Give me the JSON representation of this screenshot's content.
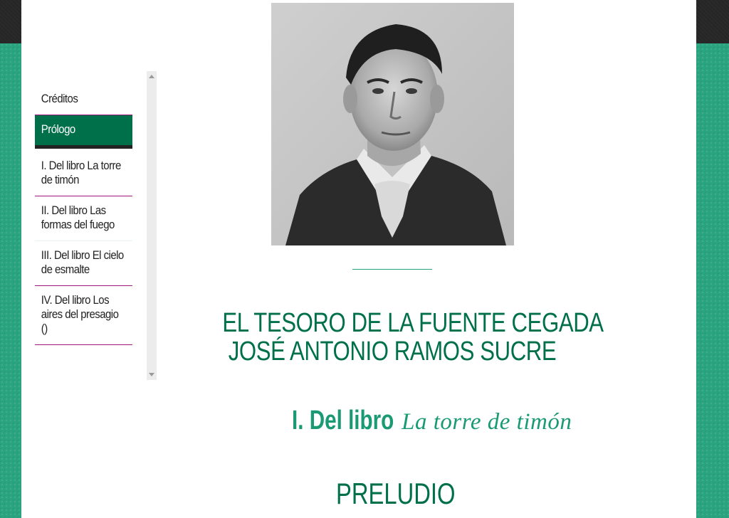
{
  "nav": {
    "items": [
      {
        "label": "Créditos",
        "active": false
      },
      {
        "label": "Prólogo",
        "active": true
      },
      {
        "label": "I. Del libro La torre de timón",
        "active": false
      },
      {
        "label": "II. Del libro Las formas del fuego",
        "active": false
      },
      {
        "label": "III. Del libro El cielo de esmalte",
        "active": false
      },
      {
        "label": "IV. Del libro Los aires del presagio ()",
        "active": false
      }
    ]
  },
  "book": {
    "title_line1": "EL TESORO DE LA FUENTE CEGADA",
    "title_line2": "JOSÉ ANTONIO RAMOS SUCRE"
  },
  "section": {
    "prefix": "I. Del libro",
    "book_name": "La torre de timón"
  },
  "poem": {
    "title": "PRELUDIO"
  },
  "colors": {
    "accent_green": "#00704a",
    "teal": "#2aa37f",
    "divider_magenta": "#a0157a",
    "top_bar": "#262626"
  },
  "icons": {
    "scroll_up": "triangle-up",
    "scroll_down": "triangle-down"
  }
}
